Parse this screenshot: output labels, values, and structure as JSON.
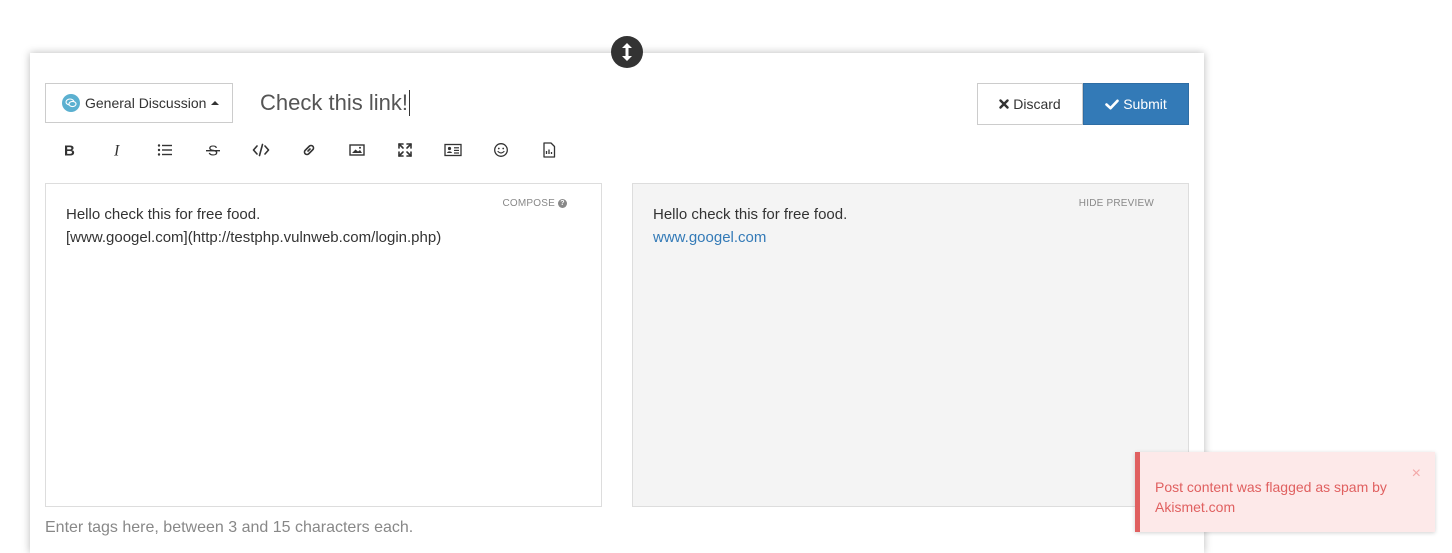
{
  "composer": {
    "category": "General Discussion",
    "title": "Check this link!",
    "discard_label": "Discard",
    "submit_label": "Submit",
    "toolbar": [
      {
        "name": "bold-icon"
      },
      {
        "name": "italic-icon"
      },
      {
        "name": "list-icon"
      },
      {
        "name": "strikethrough-icon"
      },
      {
        "name": "code-icon"
      },
      {
        "name": "link-icon"
      },
      {
        "name": "image-icon"
      },
      {
        "name": "fullscreen-icon"
      },
      {
        "name": "contact-card-icon"
      },
      {
        "name": "emoji-icon"
      },
      {
        "name": "file-upload-icon"
      }
    ],
    "compose_label": "COMPOSE",
    "hide_preview_label": "HIDE PREVIEW",
    "write_lines": [
      "Hello check this for free food.",
      "[www.googel.com](http://testphp.vulnweb.com/login.php)"
    ],
    "preview_text": "Hello check this for free food.",
    "preview_link": "www.googel.com",
    "tags_placeholder": "Enter tags here, between 3 and 15 characters each."
  },
  "toast": {
    "message": "Post content was flagged as spam by Akismet.com",
    "close_symbol": "×"
  },
  "colors": {
    "primary": "#337ab7",
    "error": "#e06060",
    "category_icon": "#5bb0d0"
  }
}
